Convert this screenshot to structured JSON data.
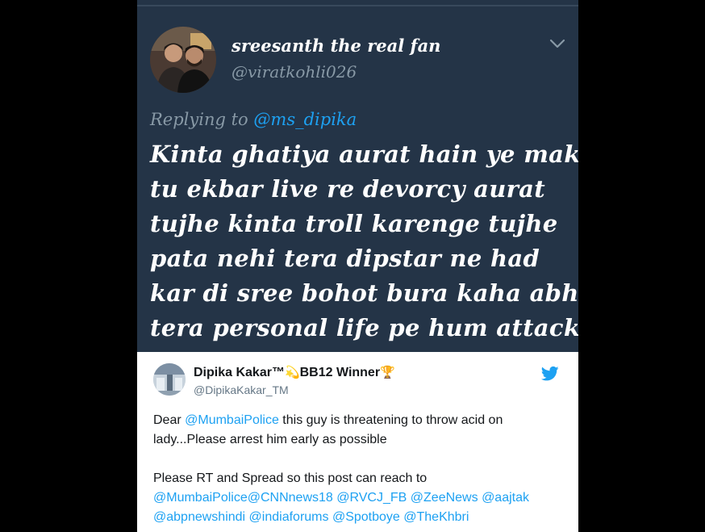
{
  "dark_tweet": {
    "display_name": "sreesanth the real fan",
    "handle": "@viratkohli026",
    "replying_prefix": "Replying to",
    "replying_to": "@ms_dipika",
    "lines": [
      "Kinta ghatiya aurat hain ye makki",
      "tu ekbar live re devorcy aurat",
      "tujhe kinta troll karenge tujhe",
      "pata nehi tera dipstar ne had",
      "kar di sree bohot bura kaha abhi",
      "tera personal life pe hum attack"
    ],
    "menu_icon": "chevron-down-icon"
  },
  "embedded_tweet": {
    "display_name": "Dipika Kakar™",
    "name_emoji_1": "💫",
    "name_middle": "BB12 Winner",
    "name_emoji_2": "🏆",
    "handle": "@DipikaKakar_TM",
    "icon": "twitter-bird-icon",
    "p1": {
      "t1": "Dear ",
      "m1": "@MumbaiPolice",
      "t2": " this guy is threatening to throw acid on lady...Please arrest him early as possible"
    },
    "p2": {
      "t1": "Please RT and Spread so this post can reach to ",
      "mentions": [
        "@MumbaiPolice",
        "@CNNnews18",
        "@RVCJ_FB",
        "@ZeeNews",
        "@aajtak",
        "@abpnewshindi",
        "@indiaforums",
        "@Spotboye",
        "@TheKhbri"
      ]
    }
  },
  "colors": {
    "dark_bg": "#243447",
    "link": "#1da1f2",
    "muted": "#8899a6",
    "page_bg": "#000000"
  }
}
